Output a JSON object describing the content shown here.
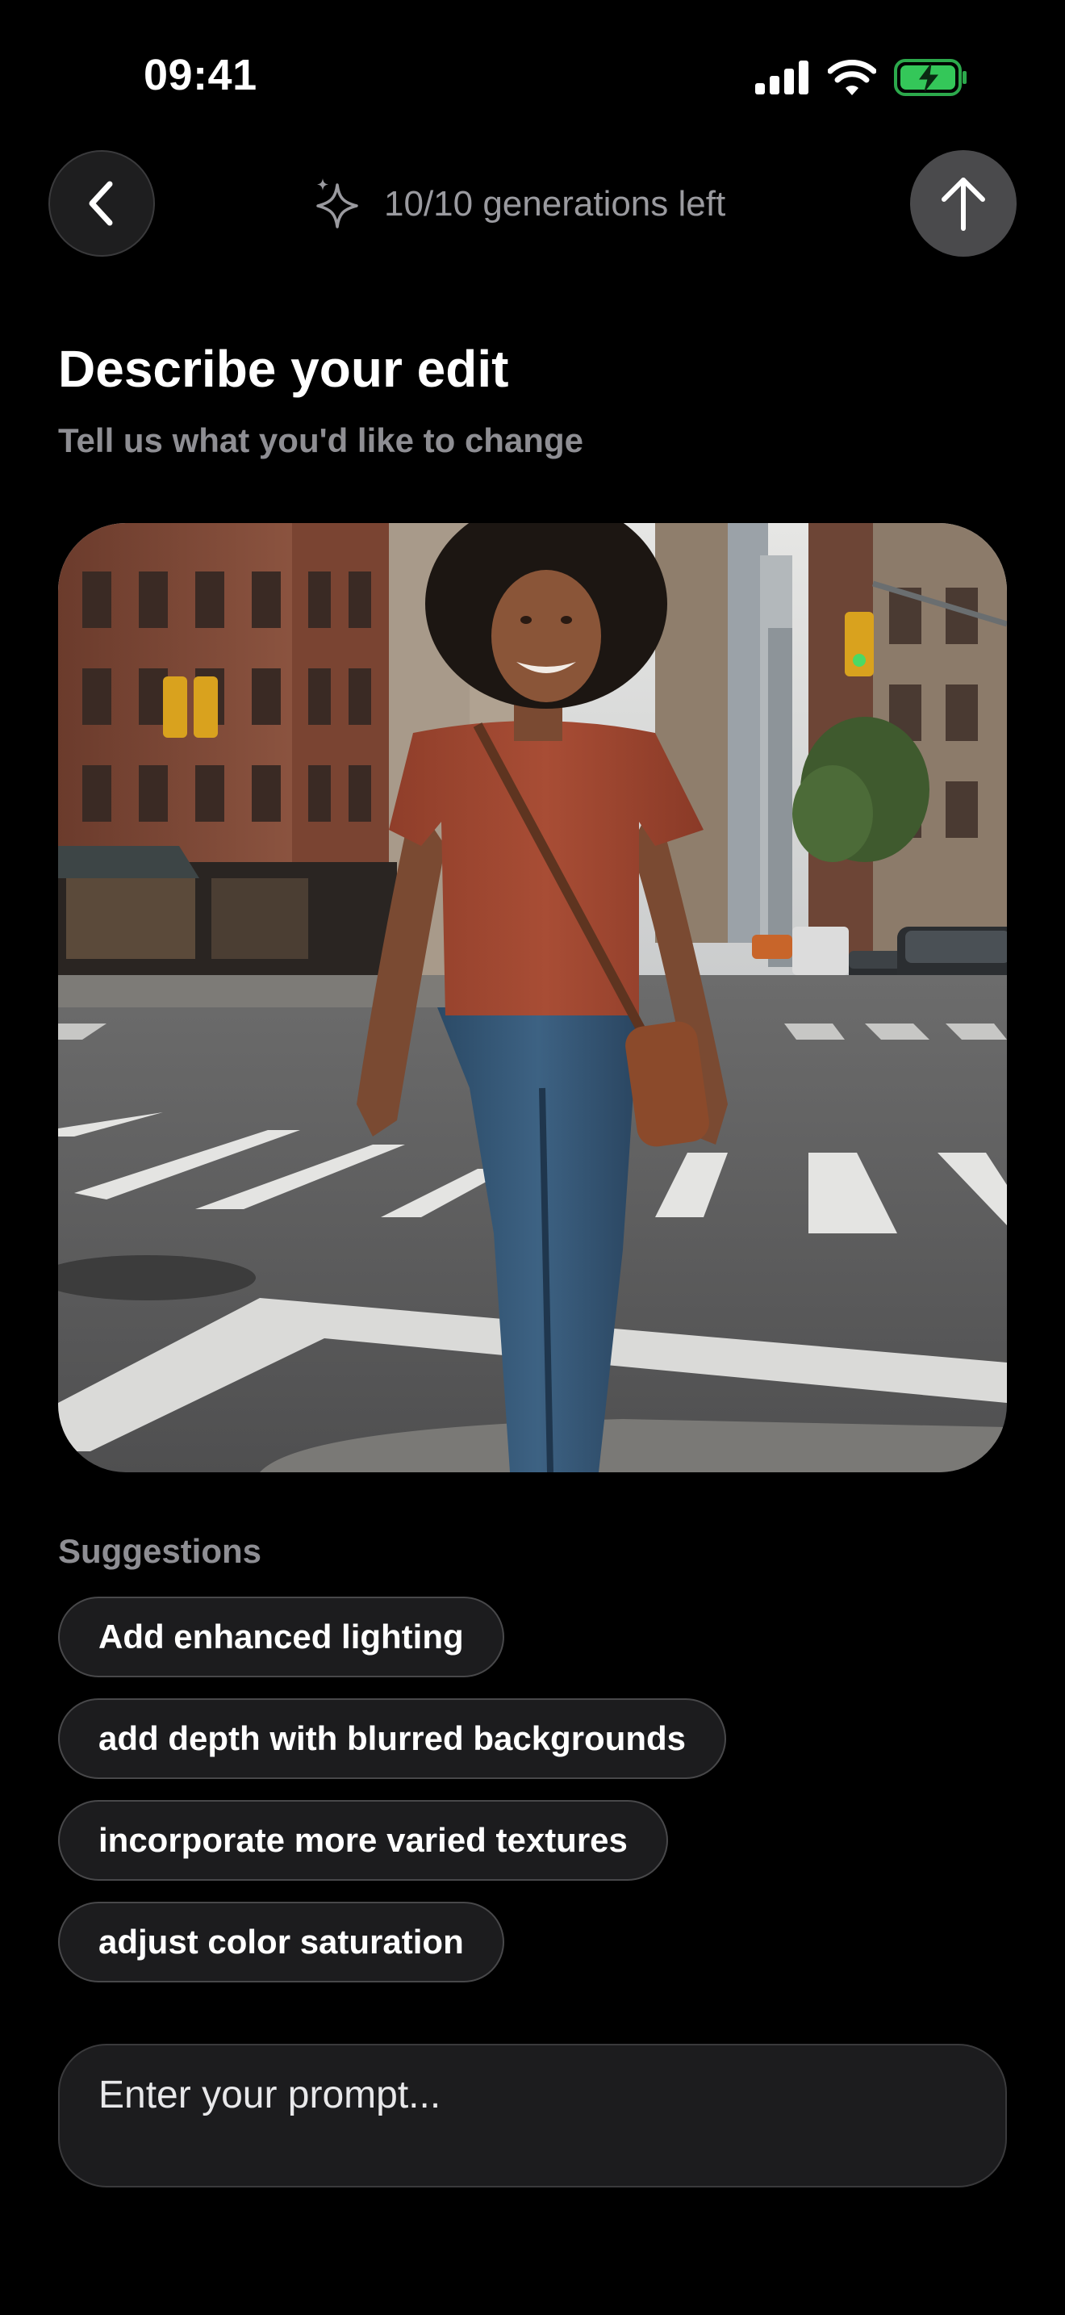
{
  "status_bar": {
    "time": "09:41"
  },
  "header": {
    "back_icon": "chevron-left-icon",
    "generations_text": "10/10 generations left",
    "sparkle_icon": "sparkle-icon",
    "upload_icon": "arrow-up-icon"
  },
  "main": {
    "title": "Describe your edit",
    "subtitle": "Tell us what you'd like to change",
    "photo_description": "Woman crossing a city street"
  },
  "suggestions": {
    "label": "Suggestions",
    "items": [
      "Add enhanced lighting",
      "add depth with blurred backgrounds",
      "incorporate more varied textures",
      "adjust color saturation"
    ]
  },
  "prompt": {
    "placeholder": "Enter your prompt..."
  },
  "colors": {
    "background": "#000000",
    "chip_bg": "#1c1c1e",
    "secondary_text": "#8e8e93",
    "battery_green": "#34c759"
  }
}
